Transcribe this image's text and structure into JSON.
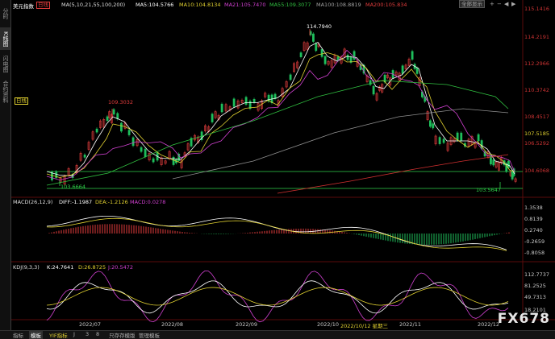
{
  "sidebar": {
    "items": [
      {
        "label": "分时"
      },
      {
        "label": "K线图"
      },
      {
        "label": "闪电图"
      },
      {
        "label": "合约资料"
      }
    ]
  },
  "main_panel": {
    "symbol": "美元指数",
    "period": "日线",
    "ma_label": "MA(5,10,21,55,100,200)",
    "ma5": "MA5:104.5766",
    "ma10": "MA10:104.8134",
    "ma21": "MA21:105.7470",
    "ma55": "MA55:109.3077",
    "ma100": "MA100:108.8819",
    "ma200": "MA200:105.834",
    "period_tag": "日线",
    "high_label": "114.7940",
    "peak2_label": "109.3032",
    "low1_label": "103.6664",
    "low2_label": "103.5647",
    "price_tag": "107.5185",
    "axis": [
      "115.1416",
      "114.2191",
      "112.2966",
      "110.3742",
      "108.4517",
      "106.5292",
      "104.6068"
    ],
    "colors": {
      "up": "#e23c3c",
      "down": "#1fbf5c",
      "ma5": "#ffffff",
      "ma10": "#e0d030",
      "ma21": "#d040d0",
      "ma55": "#30c040",
      "ma100": "#909090",
      "ma200": "#d03030"
    }
  },
  "toolbar": {
    "full_view": "全部显示"
  },
  "macd": {
    "label": "MACD(26,12,9)",
    "diff": "DIFF:-1.1987",
    "dea": "DEA:-1.2126",
    "macd": "MACD:0.0278",
    "axis": [
      "1.3538",
      "0.8139",
      "0.2740",
      "-0.2659",
      "-0.8058"
    ]
  },
  "kdj": {
    "label": "KDJ(9,3,3)",
    "k": "K:24.7641",
    "d": "D:26.8725",
    "j": "J:20.5472",
    "axis": [
      "112.7737",
      "81.2525",
      "49.7313",
      "18.2101"
    ]
  },
  "x_axis": [
    "2022/07",
    "2022/08",
    "2022/09",
    "2022/10",
    "2022/10/12 星期三",
    "2022/11",
    "2022/12"
  ],
  "bottom_tabs": [
    "指标",
    "模板",
    "YIF指标",
    "J",
    "3",
    "8",
    "只存存模版",
    "管理模板"
  ],
  "watermark": "FX678"
}
